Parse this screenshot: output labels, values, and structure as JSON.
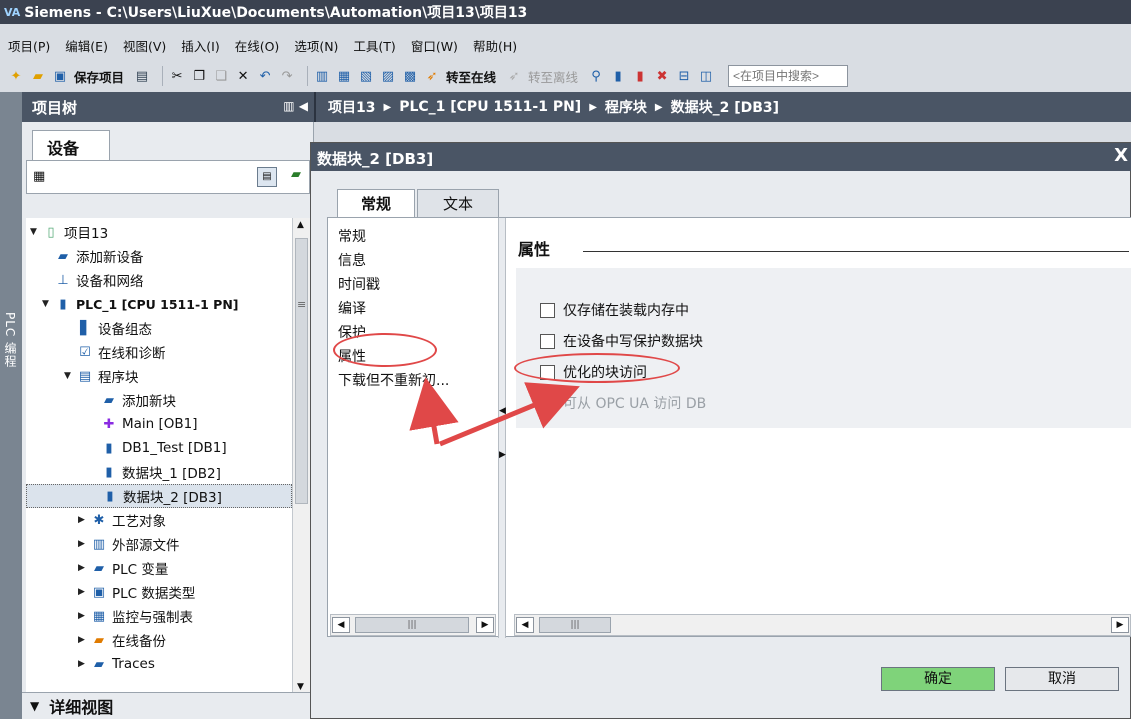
{
  "window": {
    "logo": "VA",
    "title": "Siemens  -  C:\\Users\\LiuXue\\Documents\\Automation\\项目13\\项目13"
  },
  "menu": [
    "项目(P)",
    "编辑(E)",
    "视图(V)",
    "插入(I)",
    "在线(O)",
    "选项(N)",
    "工具(T)",
    "窗口(W)",
    "帮助(H)"
  ],
  "toolbar": {
    "save_project": "保存项目",
    "go_online": "转至在线",
    "go_offline": "转至离线",
    "search_placeholder": "<在项目中搜索>"
  },
  "left_strip": "PLC 编程",
  "project_tree": {
    "header": "项目树",
    "devices_tab": "设备",
    "items": [
      {
        "label": "项目13",
        "icon": "project-icon"
      },
      {
        "label": "添加新设备",
        "icon": "add-device-icon"
      },
      {
        "label": "设备和网络",
        "icon": "network-icon"
      },
      {
        "label": "PLC_1 [CPU 1511-1 PN]",
        "icon": "plc-icon"
      },
      {
        "label": "设备组态",
        "icon": "device-config-icon"
      },
      {
        "label": "在线和诊断",
        "icon": "diagnostics-icon"
      },
      {
        "label": "程序块",
        "icon": "program-blocks-icon"
      },
      {
        "label": "添加新块",
        "icon": "add-block-icon"
      },
      {
        "label": "Main [OB1]",
        "icon": "ob-icon"
      },
      {
        "label": "DB1_Test [DB1]",
        "icon": "db-icon"
      },
      {
        "label": "数据块_1 [DB2]",
        "icon": "db-icon"
      },
      {
        "label": "数据块_2 [DB3]",
        "icon": "db-icon"
      },
      {
        "label": "工艺对象",
        "icon": "technology-icon"
      },
      {
        "label": "外部源文件",
        "icon": "source-file-icon"
      },
      {
        "label": "PLC 变量",
        "icon": "tag-icon"
      },
      {
        "label": "PLC 数据类型",
        "icon": "datatype-icon"
      },
      {
        "label": "监控与强制表",
        "icon": "watch-table-icon"
      },
      {
        "label": "在线备份",
        "icon": "backup-icon"
      },
      {
        "label": "Traces",
        "icon": "traces-icon"
      }
    ],
    "detail_view": "详细视图"
  },
  "breadcrumb": [
    "项目13",
    "PLC_1 [CPU 1511-1 PN]",
    "程序块",
    "数据块_2 [DB3]"
  ],
  "dialog": {
    "title": "数据块_2 [DB3]",
    "close": "X",
    "tabs": [
      "常规",
      "文本"
    ],
    "nav": [
      "常规",
      "信息",
      "时间戳",
      "编译",
      "保护",
      "属性",
      "下载但不重新初..."
    ],
    "section_title": "属性",
    "options": [
      {
        "label": "仅存储在装载内存中",
        "checked": false,
        "enabled": true
      },
      {
        "label": "在设备中写保护数据块",
        "checked": false,
        "enabled": true
      },
      {
        "label": "优化的块访问",
        "checked": false,
        "enabled": true
      },
      {
        "label": "可从 OPC UA 访问 DB",
        "checked": true,
        "enabled": false
      }
    ],
    "ok": "确定",
    "cancel": "取消"
  },
  "colors": {
    "titlebar": "#3b4250",
    "header": "#4a5565",
    "ok_button": "#7fd37a",
    "annotation": "#e04848"
  }
}
